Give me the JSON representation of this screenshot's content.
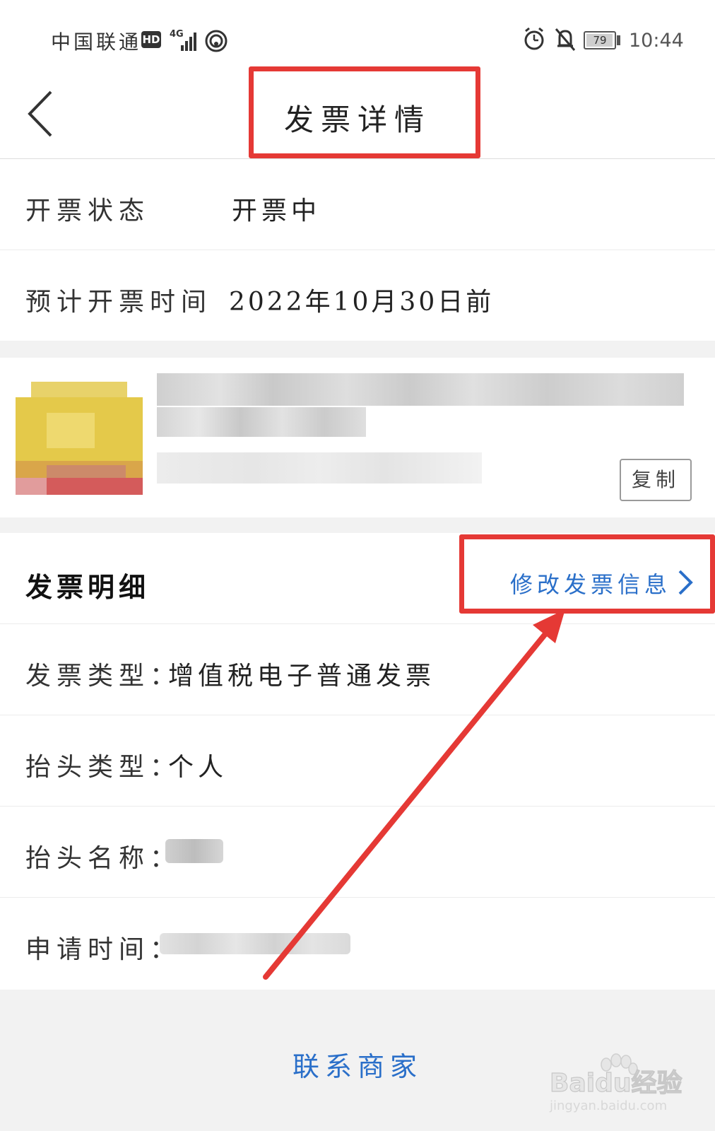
{
  "status_bar": {
    "carrier": "中国联通",
    "hd_badge": "HD",
    "network": "4G",
    "battery": "79",
    "time": "10:44"
  },
  "header": {
    "title": "发票详情"
  },
  "invoice_status": {
    "status_label": "开票状态",
    "status_value": "开票中",
    "eta_label": "预计开票时间",
    "eta_value": "2022年10月30日前"
  },
  "merchant": {
    "copy_label": "复制"
  },
  "details": {
    "section_title": "发票明细",
    "edit_link": "修改发票信息",
    "rows": [
      {
        "label": "发票类型：",
        "value": "增值税电子普通发票"
      },
      {
        "label": "抬头类型：",
        "value": "个人"
      },
      {
        "label": "抬头名称：",
        "value": ""
      },
      {
        "label": "申请时间：",
        "value": ""
      }
    ]
  },
  "footer": {
    "contact_label": "联系商家"
  },
  "watermark": {
    "brand": "Baidu经验",
    "url": "jingyan.baidu.com"
  },
  "colors": {
    "link": "#2a6fc9",
    "annotation_red": "#e53935",
    "background_gray": "#f2f2f2"
  }
}
